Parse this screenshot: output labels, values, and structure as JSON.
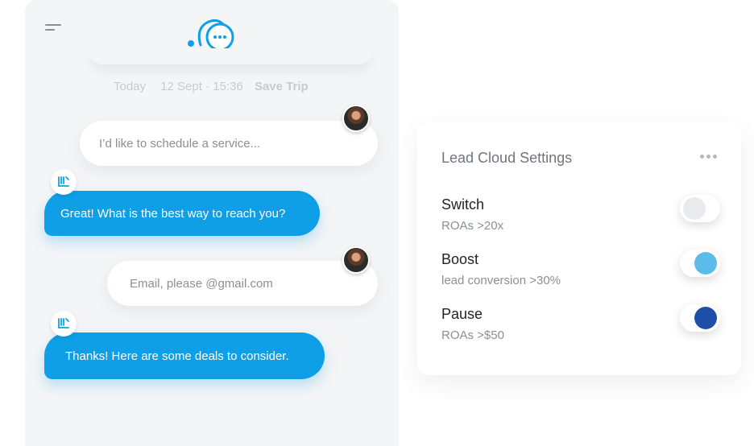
{
  "header": {
    "meta": {
      "day": "Today",
      "datetime": "12 Sept · 15:36",
      "action": "Save Trip"
    }
  },
  "chat": {
    "messages": [
      {
        "sender": "user",
        "text": "I’d like to schedule a service..."
      },
      {
        "sender": "bot",
        "text": "Great! What is the best way to reach you?"
      },
      {
        "sender": "user",
        "text": "Email, please @gmail.com"
      },
      {
        "sender": "bot",
        "text": "Thanks! Here are some deals to consider."
      }
    ]
  },
  "settings": {
    "title": "Lead Cloud Settings",
    "items": [
      {
        "name": "Switch",
        "desc": "ROAs >20x",
        "state": "off",
        "color": "#e9eaee"
      },
      {
        "name": "Boost",
        "desc": "lead conversion >30%",
        "state": "on",
        "color": "#5bbcea"
      },
      {
        "name": "Pause",
        "desc": "ROAs >$50",
        "state": "on",
        "color": "#1e4ea8"
      }
    ]
  },
  "colors": {
    "accent": "#0f9fe6",
    "panel": "#f4f5f7"
  },
  "icons": [
    "menu-icon",
    "chat-logo-icon",
    "user-avatar",
    "bot-icon",
    "more-icon"
  ]
}
